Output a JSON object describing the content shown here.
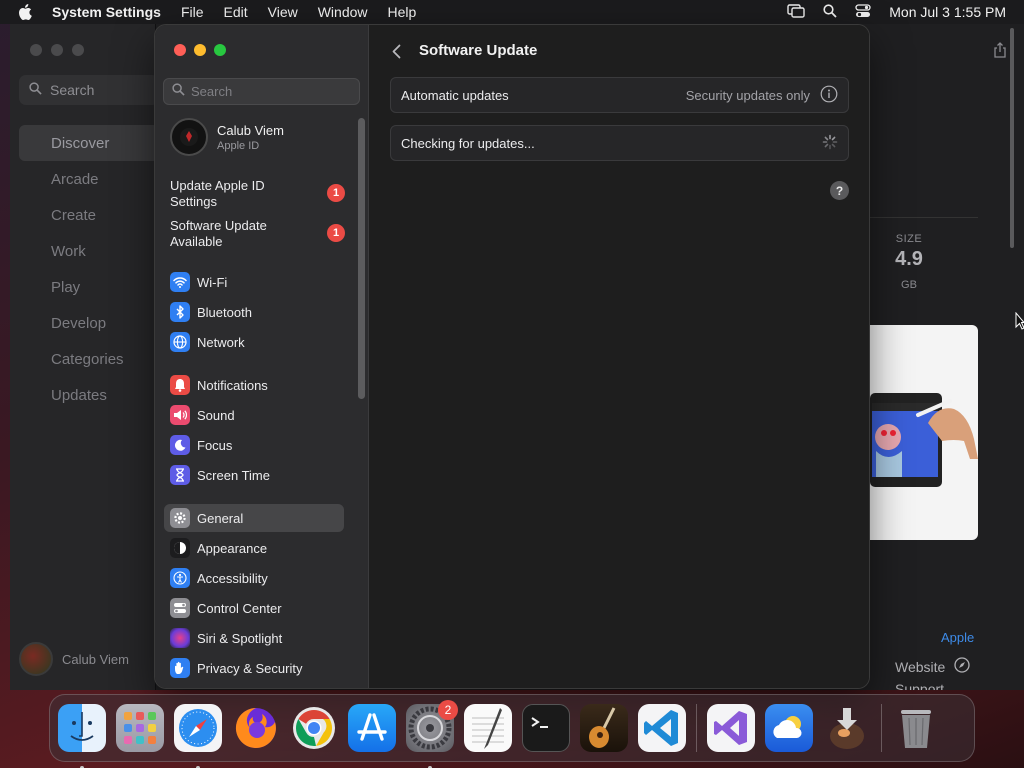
{
  "menubar": {
    "app_name": "System Settings",
    "menus": [
      "File",
      "Edit",
      "View",
      "Window",
      "Help"
    ],
    "clock": "Mon Jul 3  1:55 PM"
  },
  "app_store": {
    "search_label": "Search",
    "nav": [
      "Discover",
      "Arcade",
      "Create",
      "Work",
      "Play",
      "Develop",
      "Categories",
      "Updates"
    ],
    "user_name": "Calub Viem",
    "size_label": "SIZE",
    "size_value": "4.9",
    "size_unit": "GB",
    "developer_link": "Apple",
    "website_label": "Website",
    "support_label": "Support"
  },
  "settings": {
    "search_placeholder": "Search",
    "account": {
      "name": "Calub Viem",
      "subtitle": "Apple ID"
    },
    "notices": [
      {
        "label": "Update Apple ID Settings",
        "badge": "1"
      },
      {
        "label": "Software Update Available",
        "badge": "1"
      }
    ],
    "items": [
      {
        "label": "Wi-Fi",
        "icon": "wifi-icon",
        "color": "#2f7ff2"
      },
      {
        "label": "Bluetooth",
        "icon": "bluetooth-icon",
        "color": "#2f7ff2"
      },
      {
        "label": "Network",
        "icon": "globe-icon",
        "color": "#2f7ff2"
      },
      {
        "label": "Notifications",
        "icon": "bell-icon",
        "color": "#eb4b45"
      },
      {
        "label": "Sound",
        "icon": "speaker-icon",
        "color": "#eb4b6e"
      },
      {
        "label": "Focus",
        "icon": "moon-icon",
        "color": "#5e5ce6"
      },
      {
        "label": "Screen Time",
        "icon": "hourglass-icon",
        "color": "#5e5ce6"
      },
      {
        "label": "General",
        "icon": "gear-icon",
        "color": "#8e8e93"
      },
      {
        "label": "Appearance",
        "icon": "appearance-icon",
        "color": "#1c1c1e"
      },
      {
        "label": "Accessibility",
        "icon": "accessibility-icon",
        "color": "#2f7ff2"
      },
      {
        "label": "Control Center",
        "icon": "control-center-icon",
        "color": "#8e8e93"
      },
      {
        "label": "Siri & Spotlight",
        "icon": "siri-icon",
        "color": "#b14bd8"
      },
      {
        "label": "Privacy & Security",
        "icon": "hand-icon",
        "color": "#2f7ff2"
      }
    ],
    "selected_item": "General",
    "page_title": "Software Update",
    "automatic_updates_label": "Automatic updates",
    "automatic_updates_value": "Security updates only",
    "checking_label": "Checking for updates..."
  },
  "dock": {
    "system_settings_badge": "2",
    "apps": [
      "Finder",
      "Launchpad",
      "Safari",
      "Firefox",
      "Chrome",
      "App Store",
      "System Settings",
      "TextEdit",
      "Terminal",
      "GarageBand",
      "Visual Studio Code",
      "Visual Studio",
      "Weather",
      "Downloads",
      "Trash"
    ]
  }
}
